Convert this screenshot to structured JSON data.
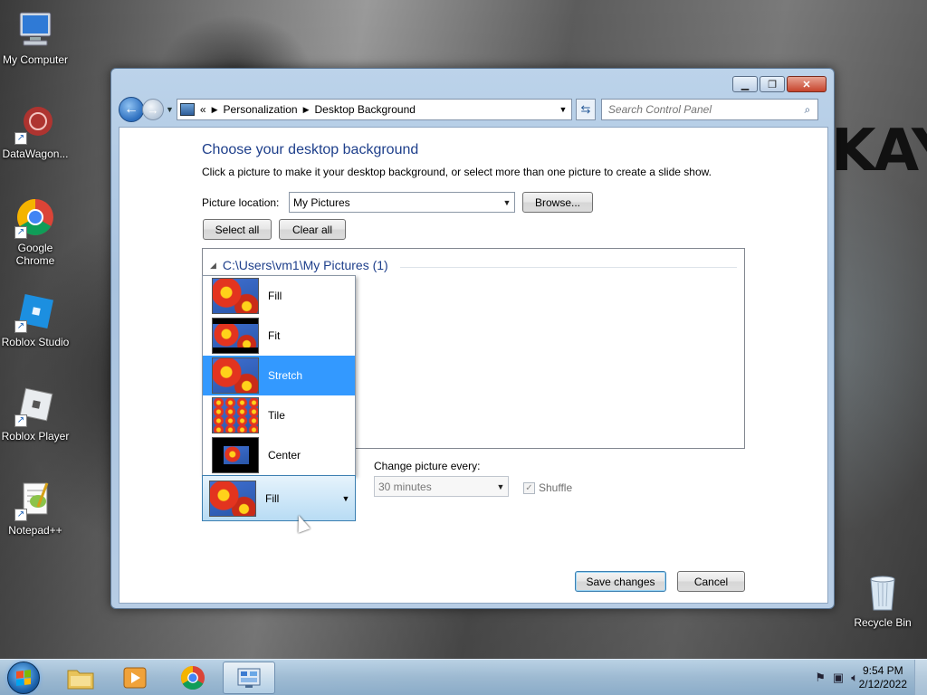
{
  "desktop": {
    "icons": [
      {
        "label": "My Computer"
      },
      {
        "label": "DataWagon..."
      },
      {
        "label": "Google Chrome"
      },
      {
        "label": "Roblox Studio"
      },
      {
        "label": "Roblox Player"
      },
      {
        "label": "Notepad++"
      },
      {
        "label": "Recycle Bin"
      }
    ],
    "wallpaper_text": "KAY"
  },
  "window": {
    "breadcrumb": {
      "overflow": "«",
      "items": [
        "Personalization",
        "Desktop Background"
      ]
    },
    "search": {
      "placeholder": "Search Control Panel"
    },
    "heading": "Choose your desktop background",
    "subtext": "Click a picture to make it your desktop background, or select more than one picture to create a slide show.",
    "picture_location": {
      "label": "Picture location:",
      "value": "My Pictures"
    },
    "browse_label": "Browse...",
    "select_all_label": "Select all",
    "clear_all_label": "Clear all",
    "folder_group": "C:\\Users\\vm1\\My Pictures (1)",
    "picture_position": {
      "selected": "Fill",
      "options": [
        "Fill",
        "Fit",
        "Stretch",
        "Tile",
        "Center"
      ],
      "highlighted": "Stretch"
    },
    "change_picture": {
      "label": "Change picture every:",
      "value": "30 minutes"
    },
    "shuffle_label": "Shuffle",
    "save_label": "Save changes",
    "cancel_label": "Cancel"
  },
  "taskbar": {
    "clock_time": "9:54 PM",
    "clock_date": "2/12/2022"
  },
  "colors": {
    "accent": "#3399ff",
    "heading": "#1e3f8b"
  }
}
